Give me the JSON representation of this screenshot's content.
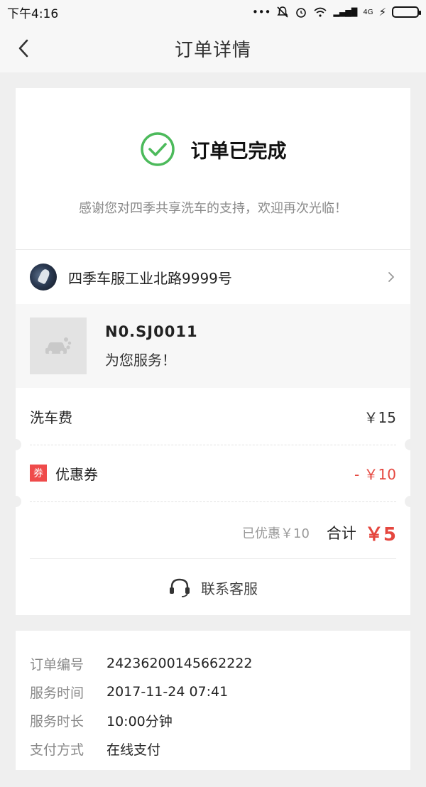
{
  "status_bar": {
    "time": "下午4:16",
    "network": "4G"
  },
  "nav": {
    "title": "订单详情"
  },
  "order_status": {
    "title": "订单已完成",
    "message": "感谢您对四季共享洗车的支持，欢迎再次光临！",
    "accent_color": "#4cba5b"
  },
  "store": {
    "name": "四季车服工业北路9999号"
  },
  "service": {
    "number": "N0.SJ0011",
    "description": "为您服务！"
  },
  "fees": {
    "wash_label": "洗车费",
    "wash_amount": "￥15",
    "coupon_badge": "券",
    "coupon_label": "优惠券",
    "coupon_amount": "- ￥10",
    "saved_text": "已优惠￥10",
    "total_label": "合计",
    "total_amount": "￥5",
    "highlight_color": "#e5473f"
  },
  "contact": {
    "label": "联系客服",
    "icon": "headset-icon"
  },
  "order_info": {
    "rows": [
      {
        "key": "订单编号",
        "value": "24236200145662222"
      },
      {
        "key": "服务时间",
        "value": "2017-11-24 07:41"
      },
      {
        "key": "服务时长",
        "value": "10:00分钟"
      },
      {
        "key": "支付方式",
        "value": "在线支付"
      }
    ]
  }
}
